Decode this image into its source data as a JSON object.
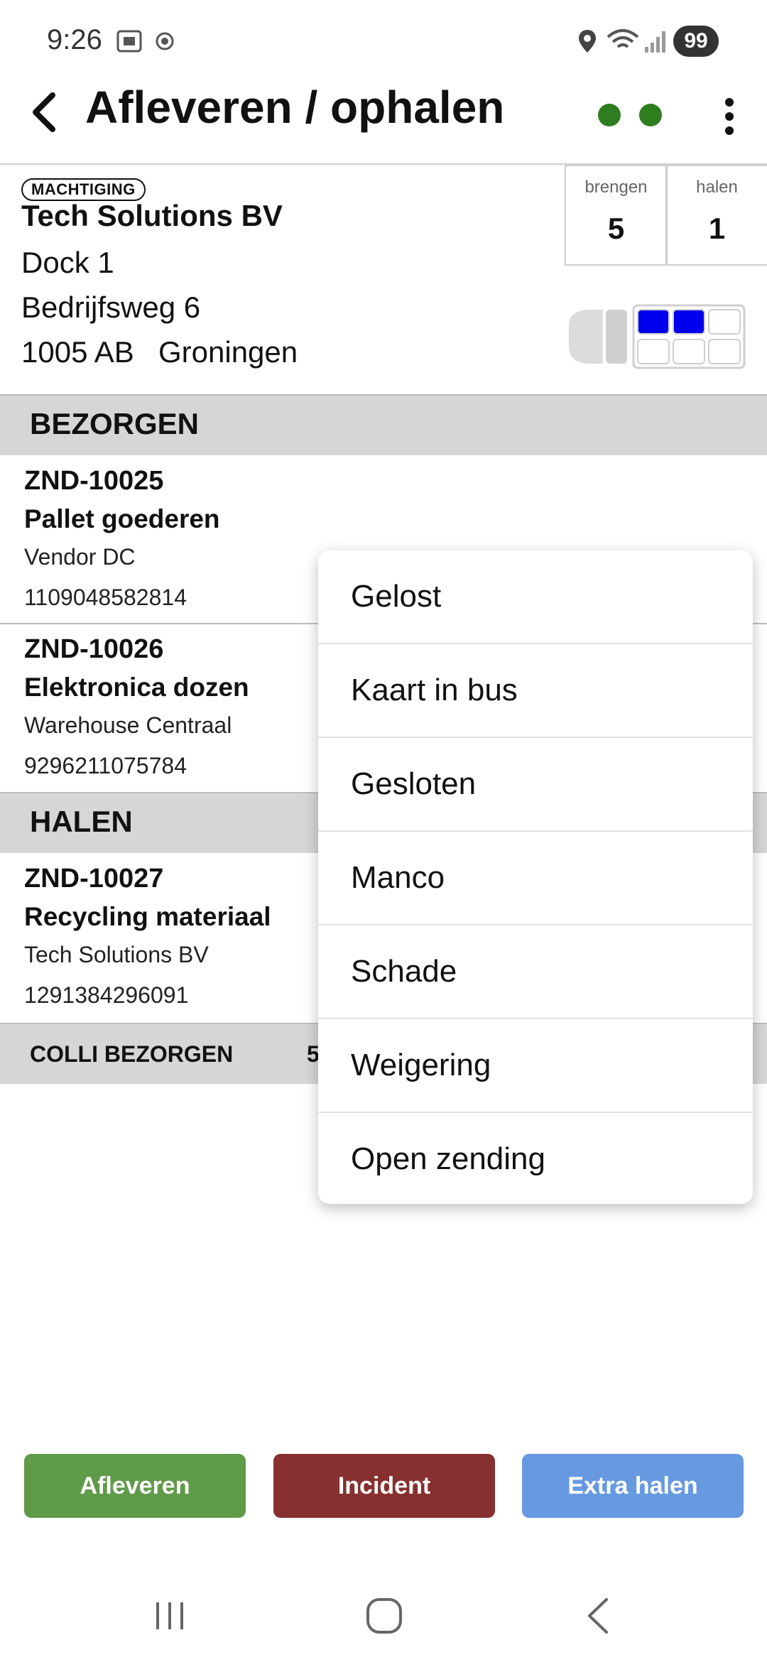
{
  "status_bar": {
    "time": "9:26",
    "battery": "99",
    "icons": [
      "screenshot-icon",
      "location-target-icon",
      "location-pin-icon",
      "wifi-icon",
      "signal-icon"
    ]
  },
  "app_bar": {
    "title": "Afleveren / ophalen",
    "status_color": "#2e7d1f"
  },
  "stop": {
    "badge": "MACHTIGING",
    "company": "Tech Solutions BV",
    "dock": "Dock 1",
    "street": "Bedrijfsweg 6",
    "postcode": "1005 AB",
    "city": "Groningen",
    "brengen_label": "brengen",
    "brengen_count": "5",
    "halen_label": "halen",
    "halen_count": "1",
    "truck_slots_filled": 2,
    "truck_slots_total": 6,
    "slot_color": "#0000ee"
  },
  "sections": {
    "bezorgen": "BEZORGEN",
    "halen": "HALEN"
  },
  "items": [
    {
      "id": "ZND-10025",
      "desc": "Pallet goederen",
      "vendor": "Vendor DC",
      "code": "1109048582814"
    },
    {
      "id": "ZND-10026",
      "desc": "Elektronica dozen",
      "vendor": "Warehouse Centraal",
      "code": "9296211075784"
    },
    {
      "id": "ZND-10027",
      "desc": "Recycling materiaal",
      "vendor": "Tech Solutions BV",
      "code": "1291384296091"
    }
  ],
  "colli": {
    "label": "COLLI BEZORGEN",
    "value": "5"
  },
  "menu": {
    "items": [
      "Gelost",
      "Kaart in bus",
      "Gesloten",
      "Manco",
      "Schade",
      "Weigering",
      "Open zending"
    ]
  },
  "buttons": {
    "afleveren": "Afleveren",
    "incident": "Incident",
    "extra_halen": "Extra halen",
    "afleveren_color": "#5f9a48",
    "incident_color": "#86302f",
    "extra_color": "#6699e0"
  }
}
